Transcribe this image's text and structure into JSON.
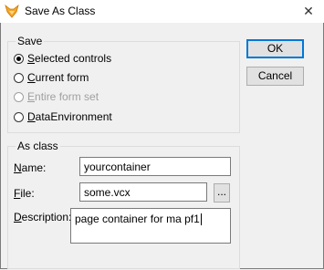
{
  "window": {
    "title": "Save As Class",
    "close_glyph": "✕",
    "app_icon": "foxpro-fox-icon"
  },
  "save_group": {
    "label": "Save",
    "options": [
      {
        "mnemonic": "S",
        "rest": "elected controls",
        "checked": true,
        "enabled": true
      },
      {
        "mnemonic": "C",
        "rest": "urrent form",
        "checked": false,
        "enabled": true
      },
      {
        "mnemonic": "E",
        "rest": "ntire form set",
        "checked": false,
        "enabled": false
      },
      {
        "mnemonic": "D",
        "rest": "ataEnvironment",
        "checked": false,
        "enabled": true
      }
    ]
  },
  "class_group": {
    "label": "As class",
    "name_label_mnemonic": "N",
    "name_label_rest": "ame:",
    "name_value": "yourcontainer",
    "file_label_mnemonic": "F",
    "file_label_rest": "ile:",
    "file_value": "some.vcx",
    "browse_label": "...",
    "description_label_mnemonic": "D",
    "description_label_rest": "escription:",
    "description_value": "page container for ma pf1"
  },
  "buttons": {
    "ok_label": "OK",
    "cancel_label": "Cancel"
  }
}
